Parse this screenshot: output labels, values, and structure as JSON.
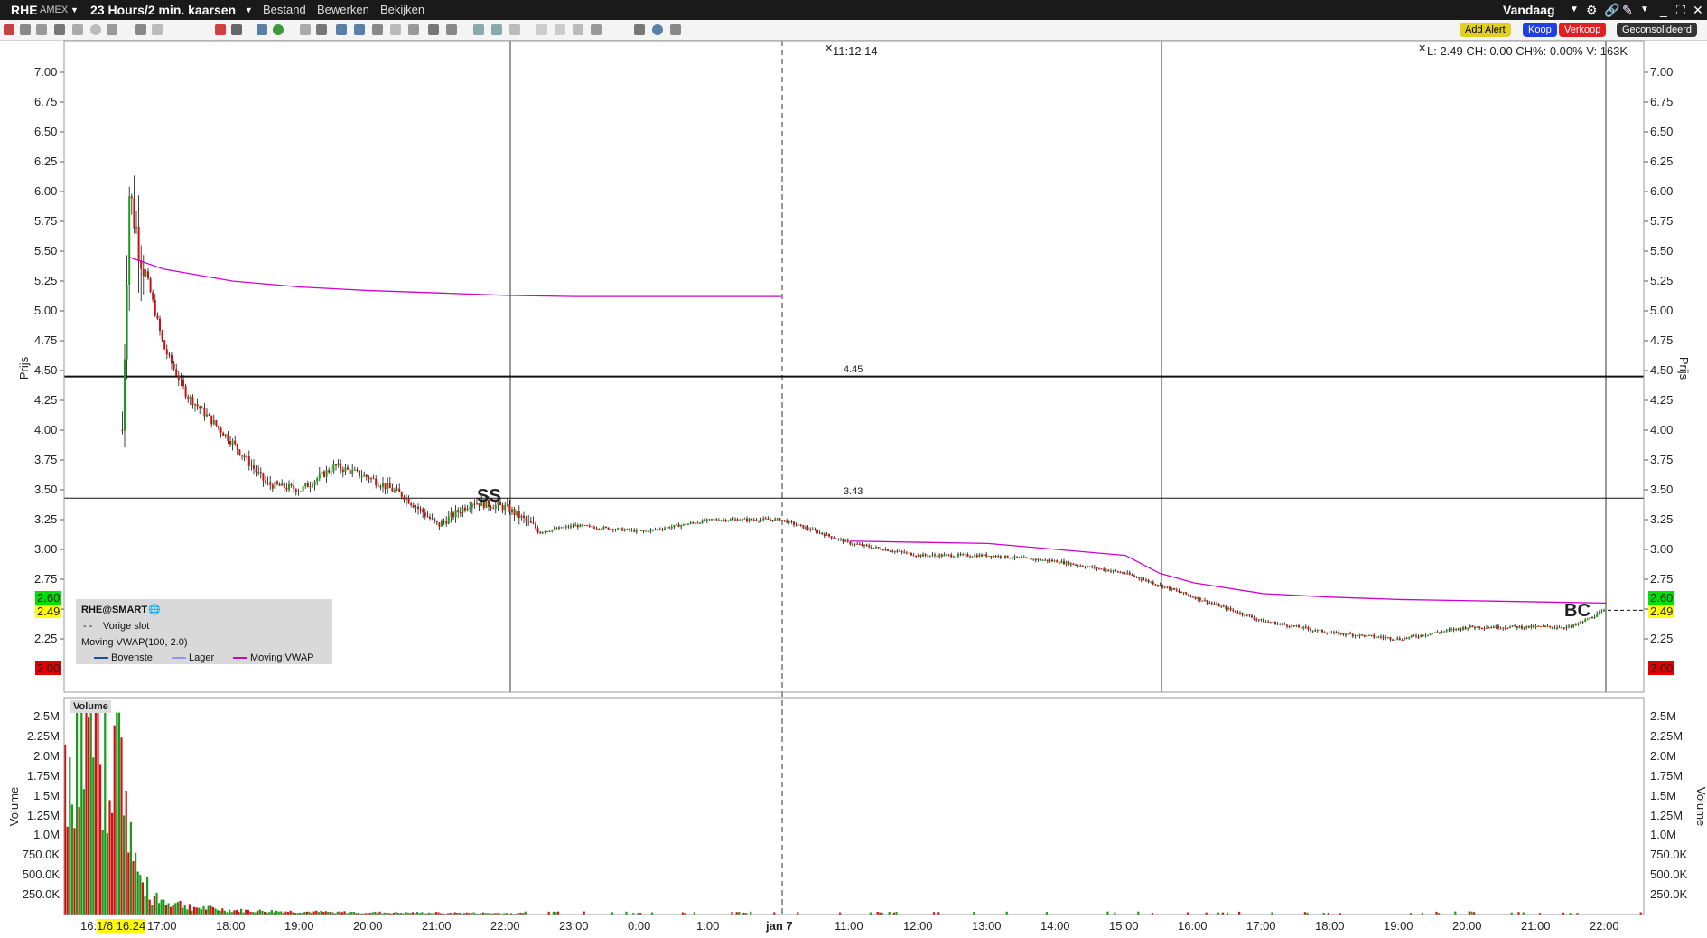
{
  "titlebar": {
    "symbol": "RHE",
    "exchange": "AMEX",
    "period": "23 Hours/2 min. kaarsen",
    "menu": [
      "Bestand",
      "Bewerken",
      "Bekijken"
    ],
    "range": "Vandaag"
  },
  "actions": {
    "alert": "Add Alert",
    "buy": "Koop",
    "sell": "Verkoop",
    "consolidated": "Geconsolideerd"
  },
  "price_panel": {
    "crosshair_time": "11:12:14",
    "info": "L: 2.49 CH: 0.00  CH%: 0.00%  V: 163K",
    "axis_title": "Prijs",
    "ticks": [
      "7.00",
      "6.75",
      "6.50",
      "6.25",
      "6.00",
      "5.75",
      "5.50",
      "5.25",
      "5.00",
      "4.75",
      "4.50",
      "4.25",
      "4.00",
      "3.75",
      "3.50",
      "3.25",
      "3.00",
      "2.75",
      "2.50",
      "2.25"
    ],
    "hline_labels": [
      "4.45",
      "3.43"
    ],
    "markers": [
      "SS",
      "BC"
    ],
    "badges": {
      "high": "2.60",
      "last": "2.49",
      "low": "2.00"
    },
    "badge_colors": {
      "high": "#00e000",
      "last": "#ffff00",
      "low": "#e00000"
    }
  },
  "legend": {
    "title": "RHE@SMART",
    "prev_close": "Vorige slot",
    "indicator": "Moving VWAP(100, 2.0)",
    "items": [
      "Bovenste",
      "Lager",
      "Moving VWAP"
    ]
  },
  "volume_panel": {
    "title": "Volume",
    "axis_title": "Volume",
    "ticks": [
      "2.5M",
      "2.25M",
      "2.0M",
      "1.75M",
      "1.5M",
      "1.25M",
      "1.0M",
      "750.0K",
      "500.0K",
      "250.0K"
    ]
  },
  "time_axis": {
    "labels": [
      "16:",
      "1/6 16:24",
      "17:00",
      "18:00",
      "19:00",
      "20:00",
      "21:00",
      "22:00",
      "23:00",
      "0:00",
      "1:00",
      "jan 7",
      "11:00",
      "12:00",
      "13:00",
      "14:00",
      "15:00",
      "16:00",
      "17:00",
      "18:00",
      "19:00",
      "20:00",
      "21:00",
      "22:00"
    ]
  },
  "chart_data": {
    "type": "candlestick",
    "title": "",
    "xlabel": "",
    "ylabel": "Prijs",
    "ylim": [
      1.9,
      7.25
    ],
    "ticker": "RHE",
    "interval": "2 min",
    "horizontal_lines": [
      4.45,
      3.43
    ],
    "prev_close": 2.49,
    "price_path": {
      "x": [
        "16:24",
        "16:30",
        "16:40",
        "17:00",
        "17:20",
        "17:40",
        "18:00",
        "18:30",
        "19:00",
        "19:30",
        "20:00",
        "20:30",
        "21:00",
        "21:30",
        "22:00",
        "22:30",
        "23:00",
        "0:00",
        "1:00",
        "2:00",
        "jan 7 11:00",
        "12:00",
        "13:00",
        "14:00",
        "15:00",
        "15:30",
        "16:00",
        "17:00",
        "17:30",
        "18:00",
        "19:00",
        "20:00",
        "21:00",
        "21:30",
        "22:00"
      ],
      "close": [
        4.0,
        6.0,
        5.5,
        4.7,
        4.3,
        4.1,
        3.9,
        3.55,
        3.5,
        3.7,
        3.6,
        3.45,
        3.2,
        3.4,
        3.35,
        3.15,
        3.2,
        3.15,
        3.25,
        3.25,
        3.05,
        2.95,
        2.95,
        2.9,
        2.8,
        2.7,
        2.6,
        2.4,
        2.35,
        2.3,
        2.25,
        2.35,
        2.35,
        2.35,
        2.49
      ]
    },
    "vwap": {
      "x": [
        "16:30",
        "17:00",
        "18:00",
        "19:00",
        "20:00",
        "21:00",
        "22:00",
        "23:00",
        "0:00",
        "1:00",
        "2:00",
        "jan 7 11:00",
        "12:00",
        "13:00",
        "14:00",
        "15:00",
        "15:30",
        "16:00",
        "17:00",
        "18:00",
        "19:00",
        "20:00",
        "21:00",
        "22:00"
      ],
      "y": [
        5.45,
        5.35,
        5.25,
        5.2,
        5.17,
        5.15,
        5.13,
        5.12,
        5.12,
        5.12,
        5.12,
        3.07,
        3.06,
        3.05,
        3.0,
        2.95,
        2.8,
        2.72,
        2.63,
        2.6,
        2.58,
        2.57,
        2.56,
        2.55
      ]
    },
    "volume": {
      "x": [
        "16:24",
        "16:28",
        "16:32",
        "16:36",
        "16:40",
        "16:50",
        "17:00",
        "17:30",
        "18:00",
        "19:00",
        "20:00",
        "21:00",
        "22:00"
      ],
      "y": [
        2500000,
        1700000,
        1100000,
        700000,
        450000,
        300000,
        200000,
        100000,
        60000,
        40000,
        30000,
        25000,
        20000
      ]
    }
  }
}
